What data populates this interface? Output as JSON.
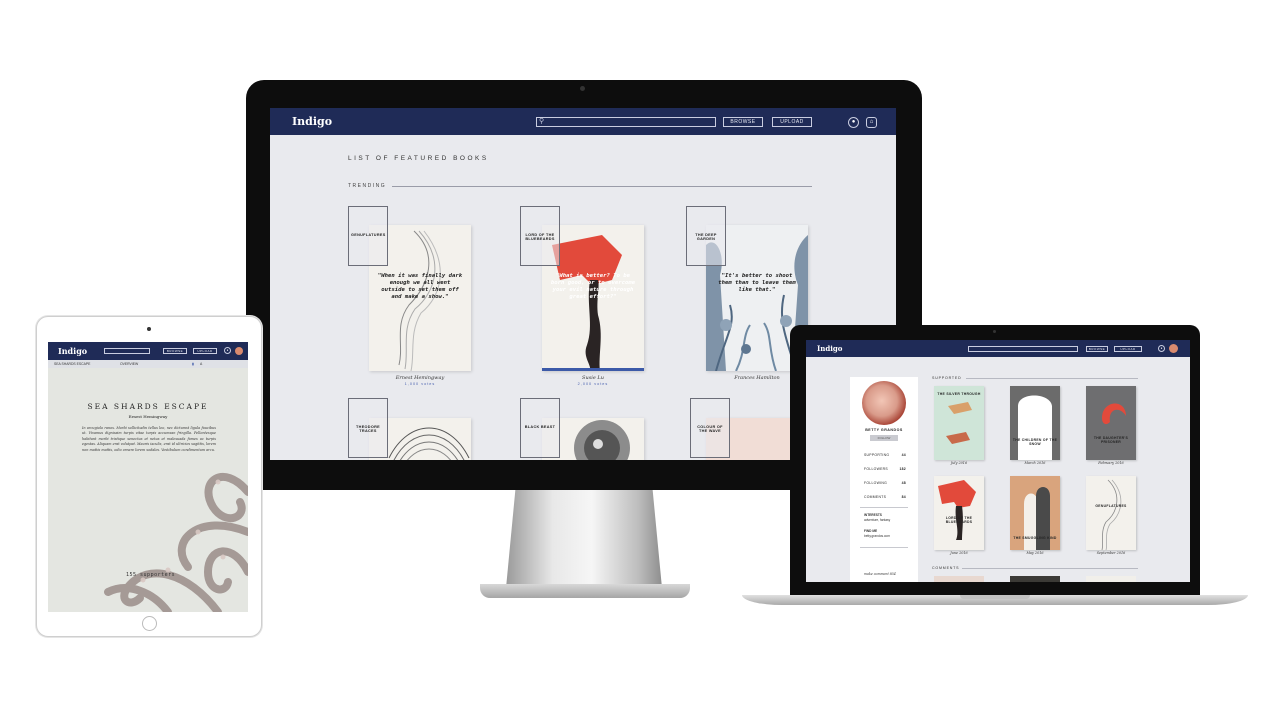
{
  "desktop": {
    "nav": {
      "logo": "Indigo",
      "browse": "BROWSE",
      "upload": "UPLOAD"
    },
    "page_title": "LIST OF FEATURED BOOKS",
    "trending_label": "TRENDING",
    "books": [
      {
        "label": "GENUFLATURES",
        "quote": "\"When it was finally dark enough we all went outside to set them off and make a show.\"",
        "author": "Ernest Hemingway",
        "votes": "1,000 votes"
      },
      {
        "label": "LORD OF THE BLUEBEARDS",
        "quote": "\"What is better? To be born good, or to overcome your evil nature through great effort?\"",
        "author": "Susie Lu",
        "votes": "2,000 votes"
      },
      {
        "label": "THE DEEP GARDEN",
        "quote": "\"It's better to shoot them than to leave them like that.\"",
        "author": "Frances Hamilton",
        "votes": ""
      },
      {
        "label": "THEODORE TRACES",
        "quote": "",
        "author": "",
        "votes": ""
      },
      {
        "label": "BLACK BEAST",
        "quote": "",
        "author": "",
        "votes": ""
      },
      {
        "label": "COLOUR OF THE WAVE",
        "quote": "",
        "author": "",
        "votes": ""
      }
    ]
  },
  "tablet": {
    "nav": {
      "logo": "Indigo",
      "browse": "BROWSE",
      "upload": "UPLOAD"
    },
    "subnav_left": "SEA SHARDS ESCAPE",
    "subnav_right": "OVERVIEW",
    "title": "SEA SHARDS ESCAPE",
    "author": "Ernest Hemingway",
    "body": "In arcugiolo ranos. Morbi sollicitudin tellus leo, nec dictumst ligula faucibus ut. Vivamus dignissim turpis vitae turpis accumsan fringilla. Pellentesque habitant morbi tristique senectus et netus et malesuada fames ac turpis egestas. Aliquam erat volutpat. Mauris iaculis, erat id ultricies sagittis, lorem non mattis mattis, odio ornare lorem sodales. Vestibulum condimentum arcu.",
    "supporters": "155 supporters"
  },
  "laptop": {
    "nav": {
      "logo": "Indigo",
      "browse": "BROWSE",
      "upload": "UPLOAD"
    },
    "profile": {
      "name": "BETTY GRANDOS",
      "follow": "FOLLOW",
      "stats": [
        {
          "label": "SUPPORTING",
          "value": "44"
        },
        {
          "label": "FOLLOWERS",
          "value": "182"
        },
        {
          "label": "FOLLOWING",
          "value": "48"
        },
        {
          "label": "COMMENTS",
          "value": "84"
        }
      ],
      "interests_label": "INTERESTS",
      "interests": "adventure, fantasy",
      "findme_label": "FIND ME",
      "findme": "betty.grandos.com",
      "more": "make comment 854"
    },
    "supported_label": "SUPPORTED",
    "comments_label": "COMMENTS",
    "books": [
      {
        "title": "THE SILVER THROUGH",
        "date": "July 2016"
      },
      {
        "title": "THE CHILDREN OF THE SNOW",
        "date": "March 2016"
      },
      {
        "title": "THE DAUGHTER'S PRISONER",
        "date": "February 2016"
      },
      {
        "title": "LORD OF THE BLUEBEARDS",
        "date": "June 2016"
      },
      {
        "title": "THE SMUGGLING KIND",
        "date": "May 2016"
      },
      {
        "title": "GENUFLATURES",
        "date": "September 2016"
      }
    ]
  },
  "colors": {
    "navy": "#1f2b57",
    "accent_red": "#e24a3b",
    "screen_bg": "#e9eaee"
  }
}
